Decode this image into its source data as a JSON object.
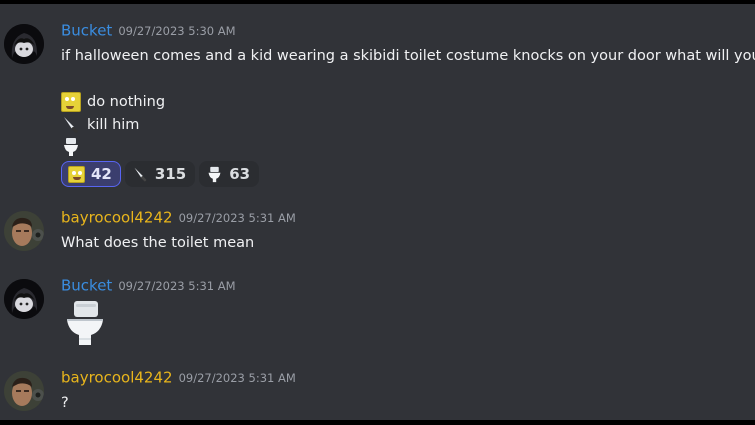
{
  "messages": [
    {
      "author": "Bucket",
      "timestamp": "09/27/2023 5:30 AM",
      "text": "if halloween comes and a kid wearing a skibidi toilet costume knocks on your door what will you do",
      "options": [
        "do nothing",
        "kill him"
      ],
      "reactions": [
        {
          "icon": "spongebob-emoji",
          "count": "42",
          "active": true
        },
        {
          "icon": "knife-emoji",
          "count": "315",
          "active": false
        },
        {
          "icon": "toilet-emoji",
          "count": "63",
          "active": false
        }
      ]
    },
    {
      "author": "bayrocool4242",
      "timestamp": "09/27/2023 5:31 AM",
      "text": "What does the toilet mean"
    },
    {
      "author": "Bucket",
      "timestamp": "09/27/2023 5:31 AM",
      "emoji": "toilet-emoji"
    },
    {
      "author": "bayrocool4242",
      "timestamp": "09/27/2023 5:31 AM",
      "text": "?"
    }
  ],
  "colors": {
    "background": "#313338",
    "bucket_name": "#3a8de0",
    "bayro_name": "#e8b51c",
    "active_reaction": "#5865f2"
  }
}
